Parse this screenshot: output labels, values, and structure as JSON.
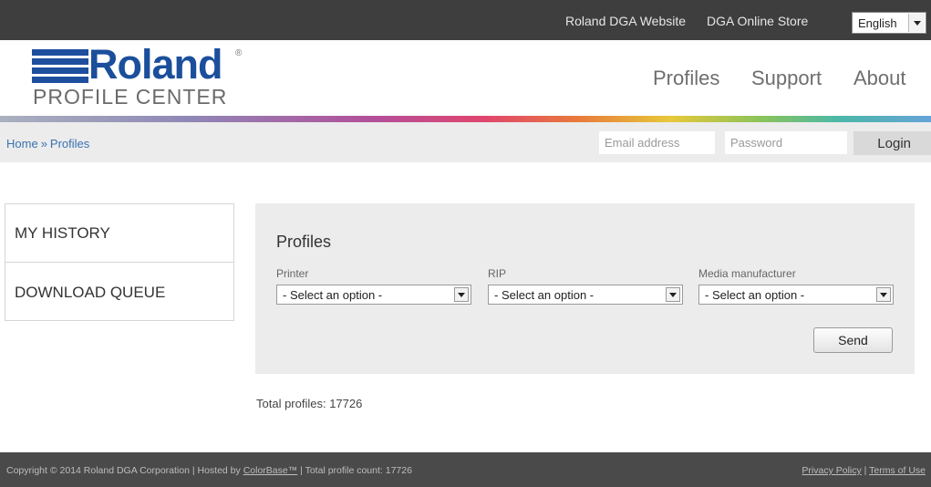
{
  "topbar": {
    "links": [
      "Roland DGA Website",
      "DGA Online Store"
    ],
    "language": "English"
  },
  "header": {
    "logo_word": "Roland",
    "logo_registered": "®",
    "logo_sub": "PROFILE CENTER",
    "nav": [
      "Profiles",
      "Support",
      "About"
    ],
    "brand_color": "#1b4f9c"
  },
  "breadcrumb": {
    "home": "Home",
    "separator": "»",
    "current": "Profiles"
  },
  "login": {
    "email_placeholder": "Email address",
    "password_placeholder": "Password",
    "button": "Login"
  },
  "sidebar": {
    "items": [
      "MY HISTORY",
      "DOWNLOAD QUEUE"
    ]
  },
  "profiles": {
    "title": "Profiles",
    "filters": [
      {
        "label": "Printer",
        "value": "- Select an option -"
      },
      {
        "label": "RIP",
        "value": "- Select an option -"
      },
      {
        "label": "Media manufacturer",
        "value": "- Select an option -"
      }
    ],
    "send_button": "Send",
    "total_text": "Total profiles: 17726"
  },
  "footer": {
    "copyright_prefix": "Copyright © 2014 Roland DGA Corporation | Hosted by ",
    "colorbase_link": "ColorBase™",
    "copyright_suffix": " | Total profile count: 17726",
    "privacy_link": "Privacy Policy",
    "divider": " | ",
    "terms_link": "Terms of Use"
  }
}
